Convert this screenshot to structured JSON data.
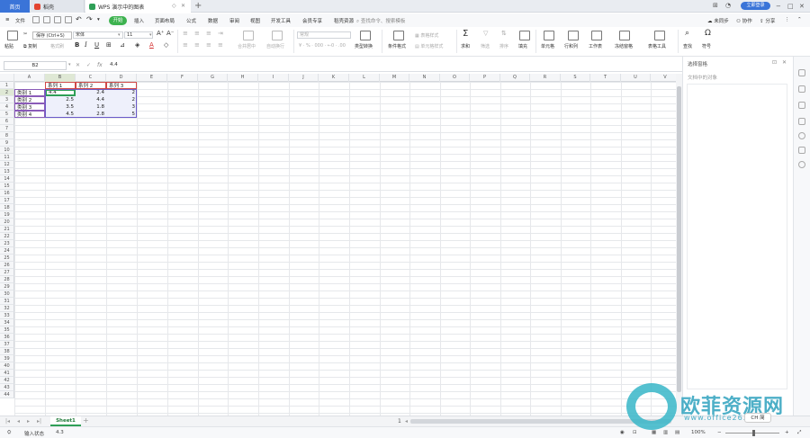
{
  "titlebar": {
    "tabs": [
      "首页",
      "稻壳",
      "WPS 演示中的图表"
    ],
    "login": "立即登录"
  },
  "menubar": {
    "file": "文件",
    "items": [
      "开始",
      "插入",
      "页面布局",
      "公式",
      "数据",
      "审阅",
      "视图",
      "开发工具",
      "会员专享",
      "稻壳资源"
    ],
    "search": "查找命令、搜索模板",
    "right": [
      "未同步",
      "协作",
      "分享"
    ]
  },
  "tooltip": "保存 (Ctrl+S)",
  "ribbon": {
    "paste": "粘贴",
    "cut": "剪切",
    "copy": "复制",
    "format_painter": "格式刷",
    "font_name": "宋体",
    "font_size": "11",
    "number_format": "常规",
    "merge": "合并居中",
    "wrap": "自动换行",
    "type_convert": "类型转换",
    "cond_format": "条件格式",
    "table_style": "表格样式",
    "cell_style": "单元格样式",
    "sum": "求和",
    "filter": "筛选",
    "sort": "排序",
    "fill": "填充",
    "cells": "单元格",
    "rowcol": "行和列",
    "sheet": "工作表",
    "freeze": "冻结窗格",
    "tools": "表格工具",
    "find": "查找",
    "symbol": "符号"
  },
  "formula": {
    "namebox": "B2",
    "fx": "fx",
    "value": "4.4"
  },
  "grid": {
    "columns": [
      "A",
      "B",
      "C",
      "D",
      "E",
      "F",
      "G",
      "H",
      "I",
      "J",
      "K",
      "L",
      "M",
      "N",
      "O",
      "P",
      "Q",
      "R",
      "S",
      "T",
      "U",
      "V"
    ],
    "active_column": "B",
    "active_row": 2,
    "row_count": 44,
    "headers": [
      "系列 1",
      "系列 2",
      "系列 3"
    ],
    "rows": [
      {
        "cat": "类别 1",
        "v": [
          "4.4",
          "2.4",
          "2"
        ]
      },
      {
        "cat": "类别 2",
        "v": [
          "2.5",
          "4.4",
          "2"
        ]
      },
      {
        "cat": "类别 3",
        "v": [
          "3.5",
          "1.8",
          "3"
        ]
      },
      {
        "cat": "类别 4",
        "v": [
          "4.5",
          "2.8",
          "5"
        ]
      }
    ]
  },
  "panel": {
    "title": "选择窗格",
    "subtitle": "文档中的对象"
  },
  "sheets": {
    "tabs": [
      "Sheet1"
    ],
    "page": "1"
  },
  "status": {
    "mode": "输入状态",
    "value": "4.3",
    "zoom": "100%"
  },
  "watermark": {
    "text": "欧菲资源网",
    "url": "www.office26.com"
  },
  "ime": "CH 简"
}
